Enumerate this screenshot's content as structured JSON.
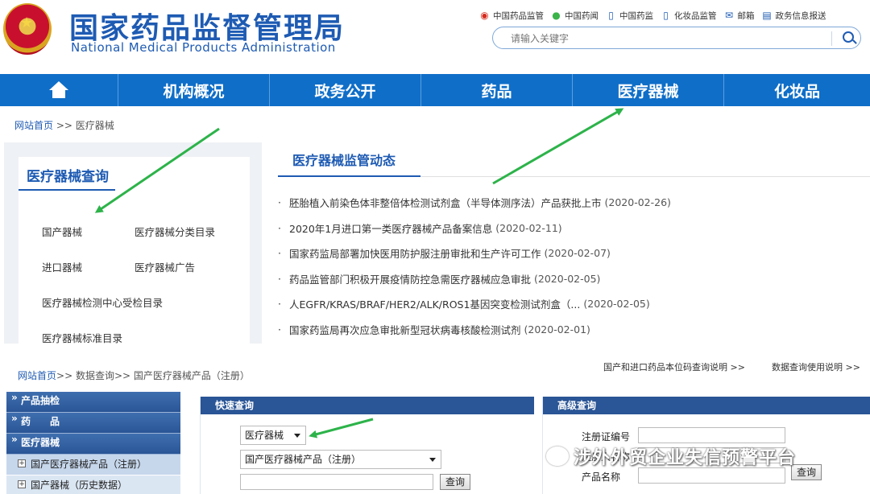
{
  "header": {
    "title_cn": "国家药品监督管理局",
    "title_en": "National Medical Products Administration",
    "top_links": [
      {
        "label": "中国药品监管",
        "icon": "weibo-icon"
      },
      {
        "label": "中国药闻",
        "icon": "wechat-icon"
      },
      {
        "label": "中国药监",
        "icon": "phone-icon"
      },
      {
        "label": "化妆品监管",
        "icon": "phone-icon"
      },
      {
        "label": "邮箱",
        "icon": "mail-icon"
      },
      {
        "label": "政务信息报送",
        "icon": "document-icon"
      }
    ],
    "search_placeholder": "请输入关键字"
  },
  "nav": {
    "items": [
      "机构概况",
      "政务公开",
      "药品",
      "医疗器械",
      "化妆品"
    ]
  },
  "breadcrumb1": {
    "home": "网站首页",
    "sep": " >> ",
    "current": "医疗器械"
  },
  "query_panel": {
    "title": "医疗器械查询",
    "links": [
      "国产器械",
      "医疗器械分类目录",
      "进口器械",
      "医疗器械广告",
      "医疗器械检测中心受检目录",
      "医疗器械标准目录"
    ]
  },
  "news": {
    "title": "医疗器械监管动态",
    "items": [
      {
        "text": "胚胎植入前染色体非整倍体检测试剂盒（半导体测序法）产品获批上市",
        "date": "(2020-02-26)"
      },
      {
        "text": "2020年1月进口第一类医疗器械产品备案信息",
        "date": "(2020-02-11)"
      },
      {
        "text": "国家药监局部署加快医用防护服注册审批和生产许可工作",
        "date": "(2020-02-07)"
      },
      {
        "text": "药品监管部门积极开展疫情防控急需医疗器械应急审批",
        "date": "(2020-02-05)"
      },
      {
        "text": "人EGFR/KRAS/BRAF/HER2/ALK/ROS1基因突变检测试剂盒（...",
        "date": "(2020-02-05)"
      },
      {
        "text": "国家药监局再次应急审批新型冠状病毒核酸检测试剂",
        "date": "(2020-02-01)"
      }
    ]
  },
  "breadcrumb2": {
    "home": "网站首页",
    "rest": ">> 数据查询>> 国产医疗器械产品（注册）"
  },
  "help_links": [
    "国产和进口药品本位码查询说明 >>",
    "数据查询使用说明 >>"
  ],
  "side_menu": {
    "items": [
      "产品抽检",
      "药　　品",
      "医疗器械"
    ],
    "subs": [
      "国产医疗器械产品（注册）",
      "国产器械（历史数据）"
    ]
  },
  "quick_query": {
    "title": "快速查询",
    "category": "医疗器械",
    "product": "国产医疗器械产品（注册）",
    "button": "查询"
  },
  "advanced_query": {
    "title": "高级查询",
    "labels": [
      "注册证编号",
      "注册人名称",
      "产品名称"
    ],
    "button": "查询"
  },
  "watermark": "涉外外贸企业失信预警平台",
  "colors": {
    "brand": "#1e5bb3",
    "nav_bg": "#0f6ec8",
    "panel_head": "#2a5596",
    "arrow": "#2db34a"
  }
}
